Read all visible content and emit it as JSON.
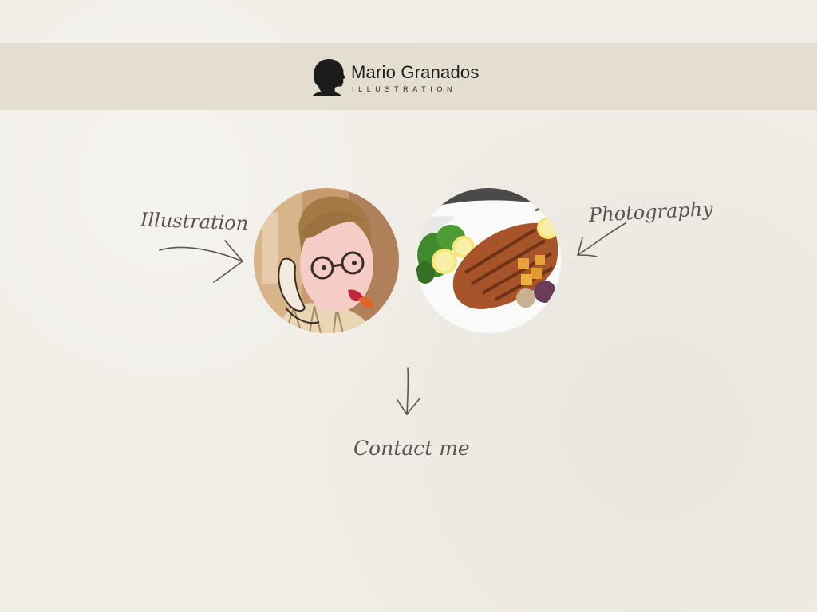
{
  "header": {
    "brand_name": "Mario Granados",
    "brand_subtitle": "ILLUSTRATION",
    "logo_icon": "silhouette-head-icon"
  },
  "nav": {
    "illustration_label": "Illustration",
    "photography_label": "Photography",
    "contact_label": "Contact me"
  },
  "thumbnails": {
    "illustration": "cartoon-man-on-phone",
    "photography": "grilled-meat-plate-with-lemon"
  },
  "colors": {
    "background": "#f0ede6",
    "header_band": "#e4ded1",
    "handwriting": "#5a5452",
    "logo": "#1c1c1c"
  }
}
